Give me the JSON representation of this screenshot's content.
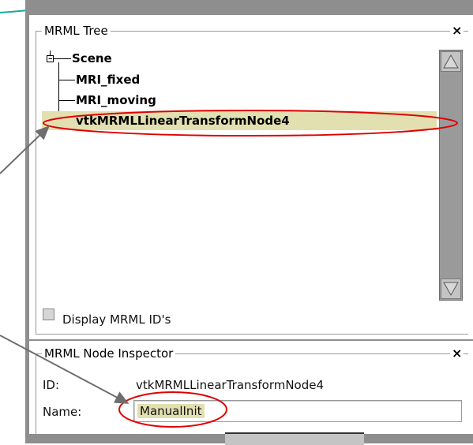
{
  "mrml_tree": {
    "title": "MRML Tree",
    "close_label": "×",
    "nodes": [
      "Scene",
      "MRI_fixed",
      "MRI_moving",
      "vtkMRMLLinearTransformNode4"
    ],
    "selected": "vtkMRMLLinearTransformNode4",
    "display_ids_label": "Display MRML ID's"
  },
  "inspector": {
    "title": "MRML Node Inspector",
    "close_label": "×",
    "id_label": "ID:",
    "id_value": "vtkMRMLLinearTransformNode4",
    "name_label": "Name:",
    "name_value": "ManualInit"
  },
  "colors": {
    "teal_annotation": "#1aa5a0",
    "red_highlight": "#e00000",
    "selection_bg": "#e2dfb0",
    "arrow": "#6e6e6e"
  }
}
